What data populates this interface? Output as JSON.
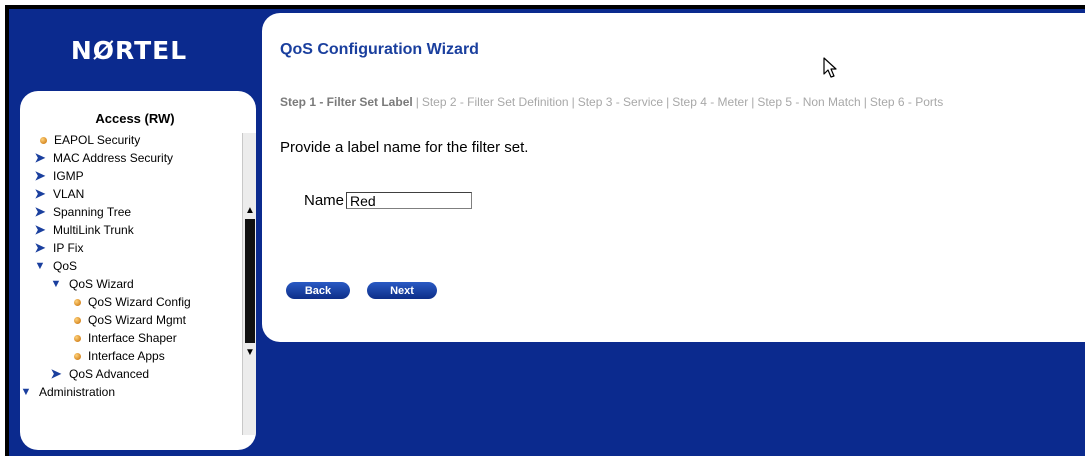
{
  "app": {
    "logo": "NØRTEL"
  },
  "sidebar": {
    "title": "Access (RW)",
    "items": [
      {
        "label": "EAPOL Security",
        "icon": "bullet-icon"
      },
      {
        "label": "MAC Address Security",
        "icon": "arrow-right-icon"
      },
      {
        "label": "IGMP",
        "icon": "arrow-right-icon"
      },
      {
        "label": "VLAN",
        "icon": "arrow-right-icon"
      },
      {
        "label": "Spanning Tree",
        "icon": "arrow-right-icon"
      },
      {
        "label": "MultiLink Trunk",
        "icon": "arrow-right-icon"
      },
      {
        "label": "IP Fix",
        "icon": "arrow-right-icon"
      },
      {
        "label": "QoS",
        "icon": "chevron-down-icon"
      },
      {
        "label": "QoS Wizard",
        "icon": "chevron-down-icon"
      },
      {
        "label": "QoS Wizard Config",
        "icon": "bullet-icon"
      },
      {
        "label": "QoS Wizard Mgmt",
        "icon": "bullet-icon"
      },
      {
        "label": "Interface Shaper",
        "icon": "bullet-icon"
      },
      {
        "label": "Interface Apps",
        "icon": "bullet-icon"
      },
      {
        "label": "QoS Advanced",
        "icon": "arrow-right-icon"
      },
      {
        "label": "Administration",
        "icon": "chevron-down-icon"
      }
    ]
  },
  "main": {
    "title": "QoS Configuration Wizard",
    "steps": [
      "Step 1 - Filter Set Label",
      "Step 2 - Filter Set Definition",
      "Step 3 - Service",
      "Step 4 - Meter",
      "Step 5 - Non Match",
      "Step 6 - Ports"
    ],
    "step_separator": "|",
    "instruction": "Provide a label name for the filter set.",
    "name_label": "Name",
    "name_value": "Red",
    "back_label": "Back",
    "next_label": "Next"
  },
  "colors": {
    "background": "#0b2a8e",
    "title": "#1a3f9e",
    "current_step": "#7a7a7a",
    "inactive_step": "#a8a8a8",
    "bullet": "#e08a00"
  }
}
